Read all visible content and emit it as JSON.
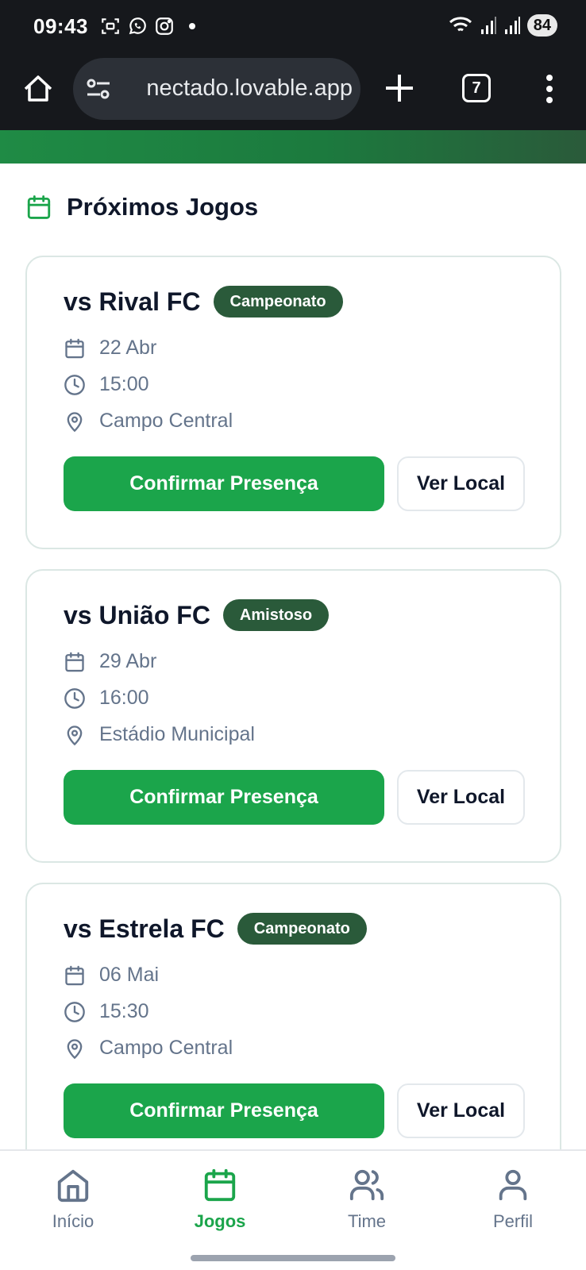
{
  "status_bar": {
    "time": "09:43",
    "battery": "84"
  },
  "browser": {
    "url": "nectado.lovable.app",
    "tab_count": "7"
  },
  "section": {
    "title": "Próximos Jogos"
  },
  "games": [
    {
      "title": "vs Rival FC",
      "badge": "Campeonato",
      "date": "22 Abr",
      "time": "15:00",
      "location": "Campo Central",
      "confirm_label": "Confirmar Presença",
      "location_button": "Ver Local"
    },
    {
      "title": "vs União FC",
      "badge": "Amistoso",
      "date": "29 Abr",
      "time": "16:00",
      "location": "Estádio Municipal",
      "confirm_label": "Confirmar Presença",
      "location_button": "Ver Local"
    },
    {
      "title": "vs Estrela FC",
      "badge": "Campeonato",
      "date": "06 Mai",
      "time": "15:30",
      "location": "Campo Central",
      "confirm_label": "Confirmar Presença",
      "location_button": "Ver Local"
    }
  ],
  "bottom_nav": {
    "items": [
      {
        "label": "Início",
        "icon": "home-icon"
      },
      {
        "label": "Jogos",
        "icon": "calendar-icon",
        "active": true
      },
      {
        "label": "Time",
        "icon": "users-icon"
      },
      {
        "label": "Perfil",
        "icon": "user-icon"
      }
    ]
  },
  "colors": {
    "accent_green": "#1ba54b",
    "badge_green": "#2a5a3a",
    "status_bar_bg": "#16181c",
    "muted_text": "#64748b"
  }
}
